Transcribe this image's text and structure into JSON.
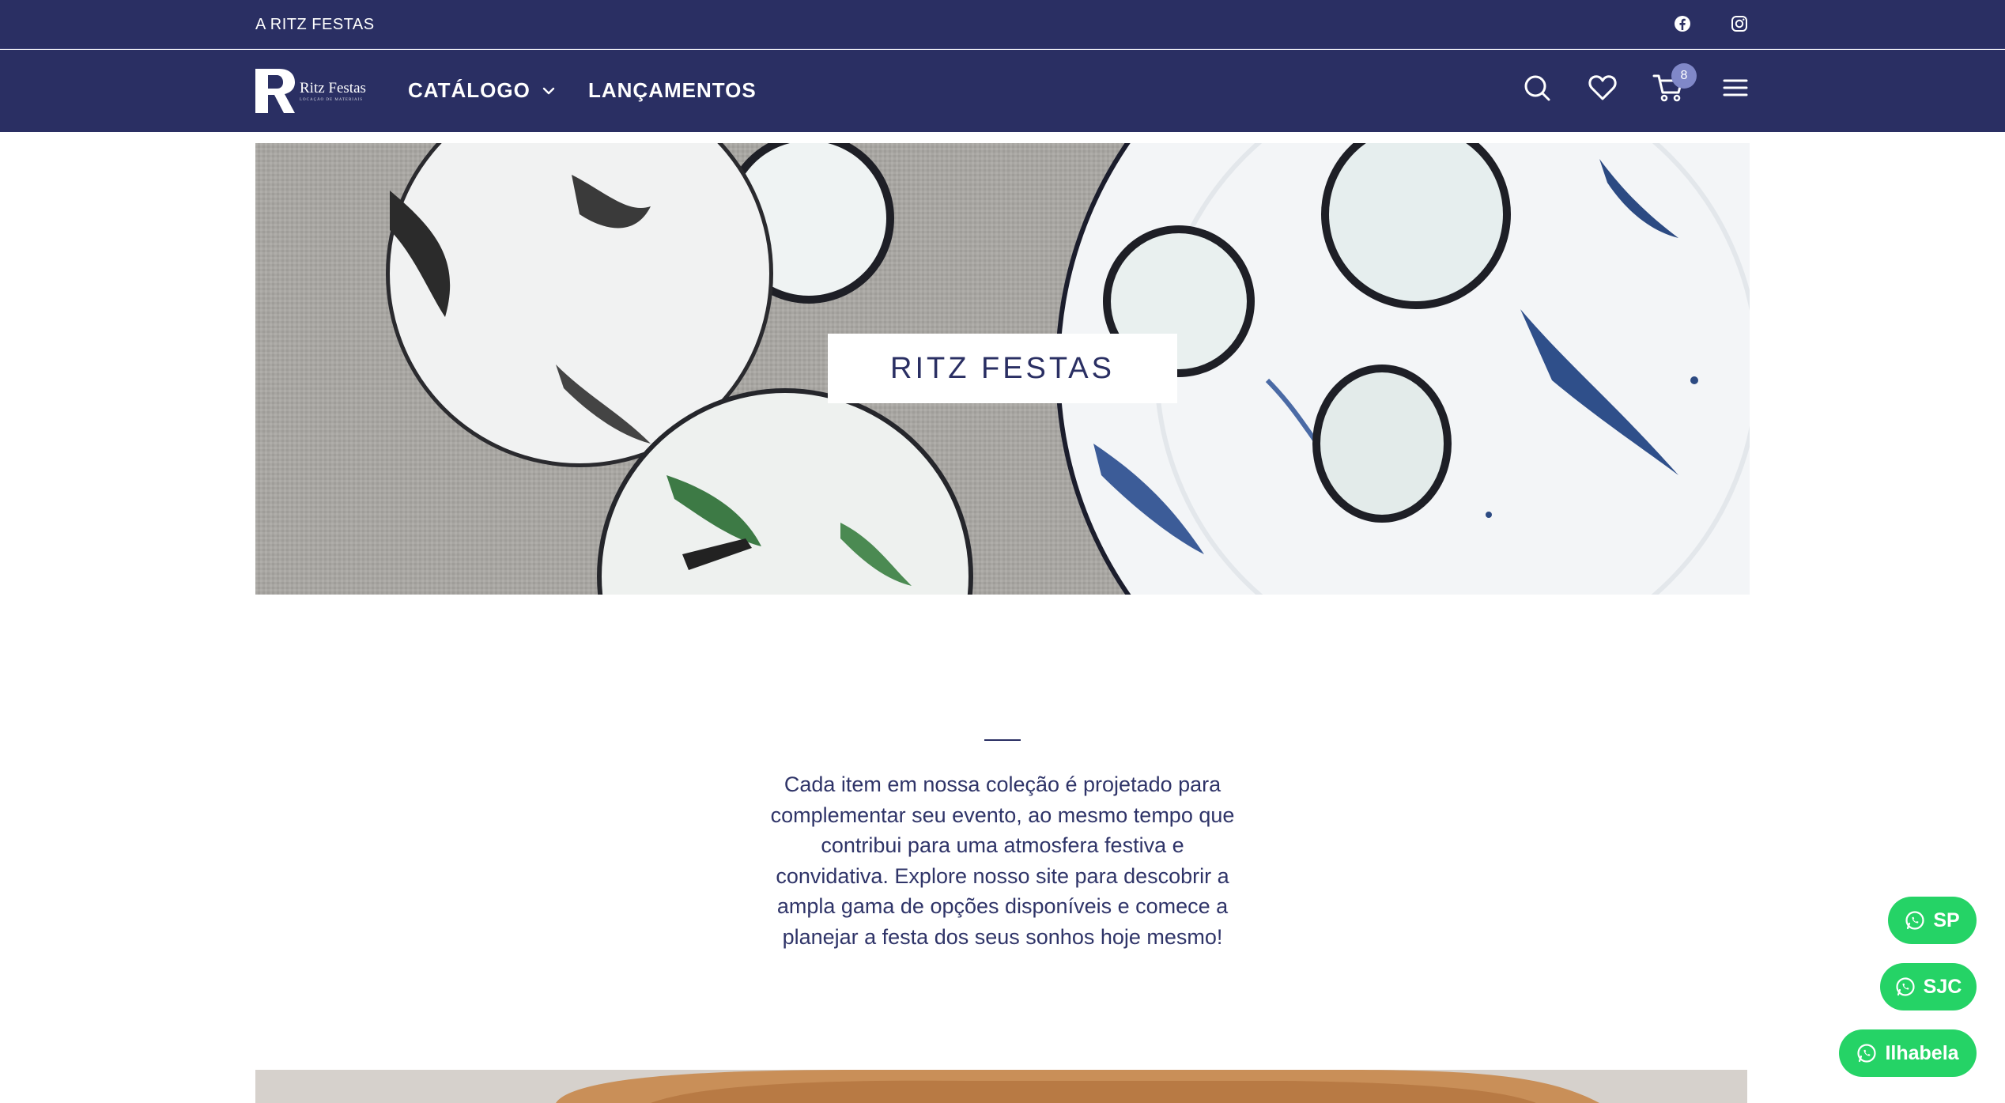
{
  "topbar": {
    "link": "A RITZ FESTAS",
    "social": {
      "facebook_icon": "facebook-icon",
      "instagram_icon": "instagram-icon"
    }
  },
  "navbar": {
    "logo_text": "Ritz Festas",
    "logo_tagline": "LOCAÇÃO DE MATERIAIS",
    "menu": [
      {
        "label": "CATÁLOGO",
        "has_dropdown": true
      },
      {
        "label": "LANÇAMENTOS",
        "has_dropdown": false
      }
    ],
    "icons": [
      "search-icon",
      "heart-icon",
      "cart-icon",
      "menu-icon"
    ],
    "cart_count": "8"
  },
  "hero": {
    "title": "RITZ FESTAS"
  },
  "intro": {
    "text": "Cada item em nossa coleção é projetado para complementar seu evento, ao mesmo tempo que contribui para uma atmosfera festiva e convidativa. Explore nosso site para descobrir a ampla gama de opções disponíveis e comece a planejar a festa dos seus sonhos hoje mesmo!"
  },
  "whatsapp": [
    {
      "label": "SP"
    },
    {
      "label": "SJC"
    },
    {
      "label": "Ilhabela"
    }
  ],
  "colors": {
    "navy": "#2a2f63",
    "badge": "#8088c8",
    "whatsapp": "#25d366"
  }
}
